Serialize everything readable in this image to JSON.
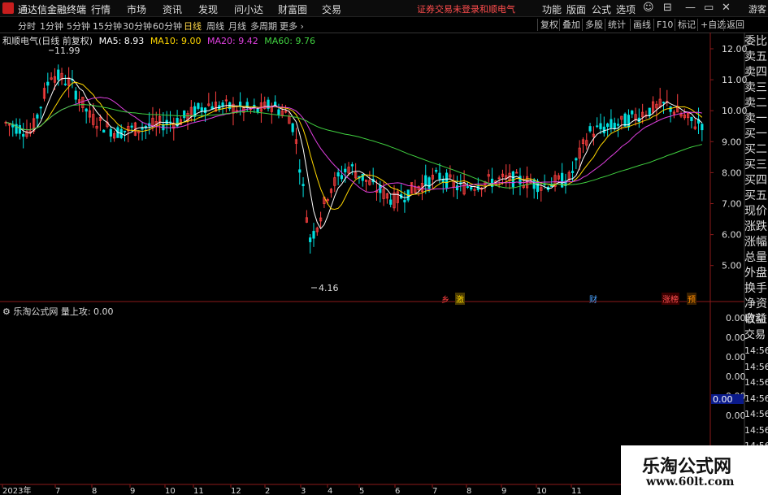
{
  "app": {
    "title": "通达信金融终端",
    "menu": [
      "行情",
      "市场",
      "资讯",
      "发现",
      "问小达",
      "财富圈",
      "交易"
    ],
    "warning": "证券交易未登录",
    "stock_name": "和顺电气",
    "right_menu": [
      "功能",
      "版面",
      "公式",
      "选项"
    ],
    "guest": "游客"
  },
  "periods": [
    "分时",
    "1分钟",
    "5分钟",
    "15分钟",
    "30分钟",
    "60分钟",
    "日线",
    "周线",
    "月线",
    "多周期",
    "更多"
  ],
  "active_period": "日线",
  "toolbar_right": [
    "复权",
    "叠加",
    "多股",
    "统计",
    "画线",
    "F10",
    "标记",
    "+自选",
    "返回"
  ],
  "main_chart": {
    "stock_label": "和顺电气(日线 前复权)",
    "ma": [
      {
        "name": "MA5: 8.93",
        "color": "#ffffff"
      },
      {
        "name": "MA10: 9.00",
        "color": "#ffd700"
      },
      {
        "name": "MA20: 9.42",
        "color": "#e040e0"
      },
      {
        "name": "MA60: 9.76",
        "color": "#40d040"
      }
    ],
    "max_label": "11.99",
    "min_label": "4.16",
    "price_ticks": [
      "12.00",
      "11.00",
      "10.00",
      "9.00",
      "8.00",
      "7.00",
      "6.00",
      "5.00"
    ],
    "events": [
      {
        "label": "乡",
        "color": "#ff4040"
      },
      {
        "label": "激",
        "color": "#ffd700"
      },
      {
        "label": "财",
        "color": "#4aa3ff"
      },
      {
        "label": "涨榜",
        "color": "#ff5050"
      },
      {
        "label": "预",
        "color": "#ff8c00"
      }
    ]
  },
  "sub_chart": {
    "label": "乐淘公式网 量上攻: 0.00",
    "ticks": [
      "0.00",
      "0.00",
      "0.00",
      "0.00",
      "0.00",
      "0.00"
    ],
    "current": "0.00"
  },
  "right_panel": [
    "委比",
    "卖五",
    "卖四",
    "卖三",
    "卖二",
    "卖一",
    "买一",
    "买二",
    "买三",
    "买四",
    "买五",
    "现价",
    "涨跌",
    "涨幅",
    "总量",
    "外盘",
    "换手",
    "净资",
    "收益"
  ],
  "right_panel2": [
    "自动",
    "交易",
    "14:56",
    "14:56",
    "14:56",
    "14:56",
    "14:56",
    "14:56",
    "14:56",
    "14:56",
    "14:56"
  ],
  "time_axis": [
    "2023年",
    "7",
    "8",
    "9",
    "10",
    "11",
    "12",
    "2",
    "3",
    "4",
    "5",
    "6",
    "7",
    "8",
    "9",
    "10",
    "11"
  ],
  "watermark": {
    "line1": "乐淘公式网",
    "line2": "www.60lt.com"
  }
}
